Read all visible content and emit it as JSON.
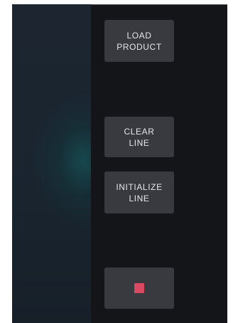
{
  "buttons": {
    "load_product": {
      "line1": "LOAD",
      "line2": "PRODUCT"
    },
    "clear_line": {
      "line1": "CLEAR",
      "line2": "LINE"
    },
    "initialize_line": {
      "line1": "INITIALIZE",
      "line2": "LINE"
    },
    "stop": {
      "icon": "stop-square-icon",
      "icon_color": "#d94a62"
    }
  },
  "colors": {
    "panel_background": "#141519",
    "button_background": "#393a3f",
    "button_text": "#e6e6e8",
    "left_panel_glow": "#164e52"
  }
}
